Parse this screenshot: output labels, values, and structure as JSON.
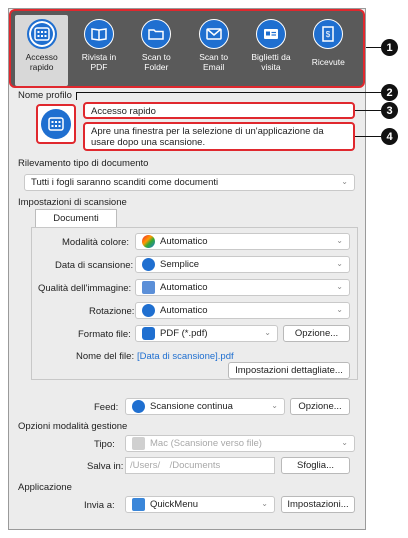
{
  "toolbar": {
    "items": [
      {
        "label": "Accesso\nrapido",
        "icon": "grid-icon"
      },
      {
        "label": "Rivista in\nPDF",
        "icon": "book-icon"
      },
      {
        "label": "Scan to\nFolder",
        "icon": "folder-icon"
      },
      {
        "label": "Scan to\nEmail",
        "icon": "envelope-icon"
      },
      {
        "label": "Biglietti da\nvisita",
        "icon": "card-icon"
      },
      {
        "label": "Ricevute",
        "icon": "receipt-icon"
      }
    ]
  },
  "callouts": [
    "1",
    "2",
    "3",
    "4"
  ],
  "profile": {
    "section_label": "Nome profilo",
    "name_value": "Accesso rapido",
    "description": "Apre una finestra per la selezione di un'applicazione da usare dopo una scansione."
  },
  "doc_detection": {
    "label": "Rilevamento tipo di documento",
    "value": "Tutti i fogli saranno scanditi come documenti"
  },
  "scan_settings": {
    "label": "Impostazioni di scansione",
    "tab": "Documenti",
    "rows": [
      {
        "label": "Modalità colore:",
        "value": "Automatico"
      },
      {
        "label": "Data di scansione:",
        "value": "Semplice"
      },
      {
        "label": "Qualità dell'immagine:",
        "value": "Automatico"
      },
      {
        "label": "Rotazione:",
        "value": "Automatico"
      }
    ],
    "format_label": "Formato file:",
    "format_value": "PDF (*.pdf)",
    "format_button": "Opzione...",
    "filename_label": "Nome del file:",
    "filename_value": "[Data di scansione].pdf",
    "detailed_button": "Impostazioni dettagliate..."
  },
  "feed": {
    "label": "Feed:",
    "value": "Scansione continua",
    "button": "Opzione..."
  },
  "management": {
    "label": "Opzioni modalità gestione",
    "type_label": "Tipo:",
    "type_value": "Mac (Scansione verso file)",
    "save_label": "Salva in:",
    "save_value": "/Users/     /Documents",
    "browse_button": "Sfoglia..."
  },
  "application": {
    "label": "Applicazione",
    "send_label": "Invia a:",
    "send_value": "QuickMenu",
    "settings_button": "Impostazioni..."
  },
  "colors": {
    "accent": "#1f6fd0",
    "callout_red": "#e0282e"
  }
}
